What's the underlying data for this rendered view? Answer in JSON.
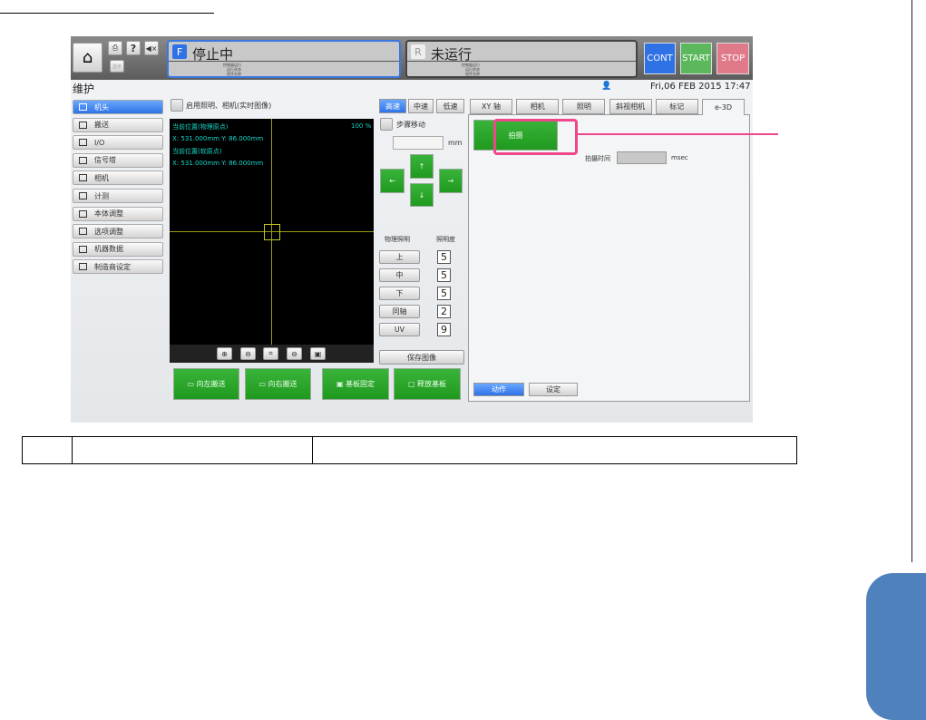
{
  "header": {
    "small_btn_label": "显示",
    "help_label": "?",
    "f_panel": {
      "badge": "F",
      "status": "停止中",
      "sub_lines": [
        "控制器运行",
        "运行状态",
        "程序名称"
      ]
    },
    "r_panel": {
      "badge": "R",
      "status": "未运行",
      "sub_lines": [
        "控制器运行",
        "运行状态",
        "程序名称"
      ]
    },
    "cont": "CONT",
    "start": "START",
    "stop": "STOP"
  },
  "title_bar": {
    "title": "维护",
    "datetime": "Fri,06 FEB 2015  17:47"
  },
  "sidebar": {
    "items": [
      {
        "label": "机头",
        "active": true
      },
      {
        "label": "搬送"
      },
      {
        "label": "I/O"
      },
      {
        "label": "信号塔"
      },
      {
        "label": "相机"
      },
      {
        "label": "计测"
      },
      {
        "label": "本体调整"
      },
      {
        "label": "选项调整"
      },
      {
        "label": "机器数据"
      },
      {
        "label": "制造商设定"
      }
    ]
  },
  "camera": {
    "enable_label": "启用照明、相机(实时图像)",
    "zoom": "100 %",
    "pos1_label": "当前位置(物理原点)",
    "pos1_value": "X: 531.000mm  Y: 86.000mm",
    "pos2_label": "当前位置(软原点)",
    "pos2_value": "X: 531.000mm  Y: 86.000mm"
  },
  "transport": {
    "left": "向左搬送",
    "right": "向右搬送",
    "fix": "基板固定",
    "release": "释放基板"
  },
  "jog": {
    "speeds": [
      "高速",
      "中速",
      "低速"
    ],
    "step_label": "步骤移动",
    "step_value": "",
    "unit": "mm",
    "lighting_label": "物理照明",
    "brightness_label": "照明度",
    "lights": [
      {
        "label": "上",
        "value": "5"
      },
      {
        "label": "中",
        "value": "5"
      },
      {
        "label": "下",
        "value": "5"
      },
      {
        "label": "同轴",
        "value": "2"
      },
      {
        "label": "UV",
        "value": "9"
      }
    ],
    "save_image": "保存图像"
  },
  "tabs": [
    "XY 轴",
    "相机",
    "照明",
    "斜视相机",
    "标记",
    "e-3D"
  ],
  "active_tab": "e-3D",
  "e3d": {
    "capture": "拍摄",
    "capture_time_label": "拍摄时间",
    "capture_time_value": "",
    "capture_time_unit": "msec",
    "action": "动作",
    "settings": "设定"
  },
  "colors": {
    "highlight": "#f0468c",
    "accent": "#2f72e6",
    "green": "#2aa72a"
  }
}
